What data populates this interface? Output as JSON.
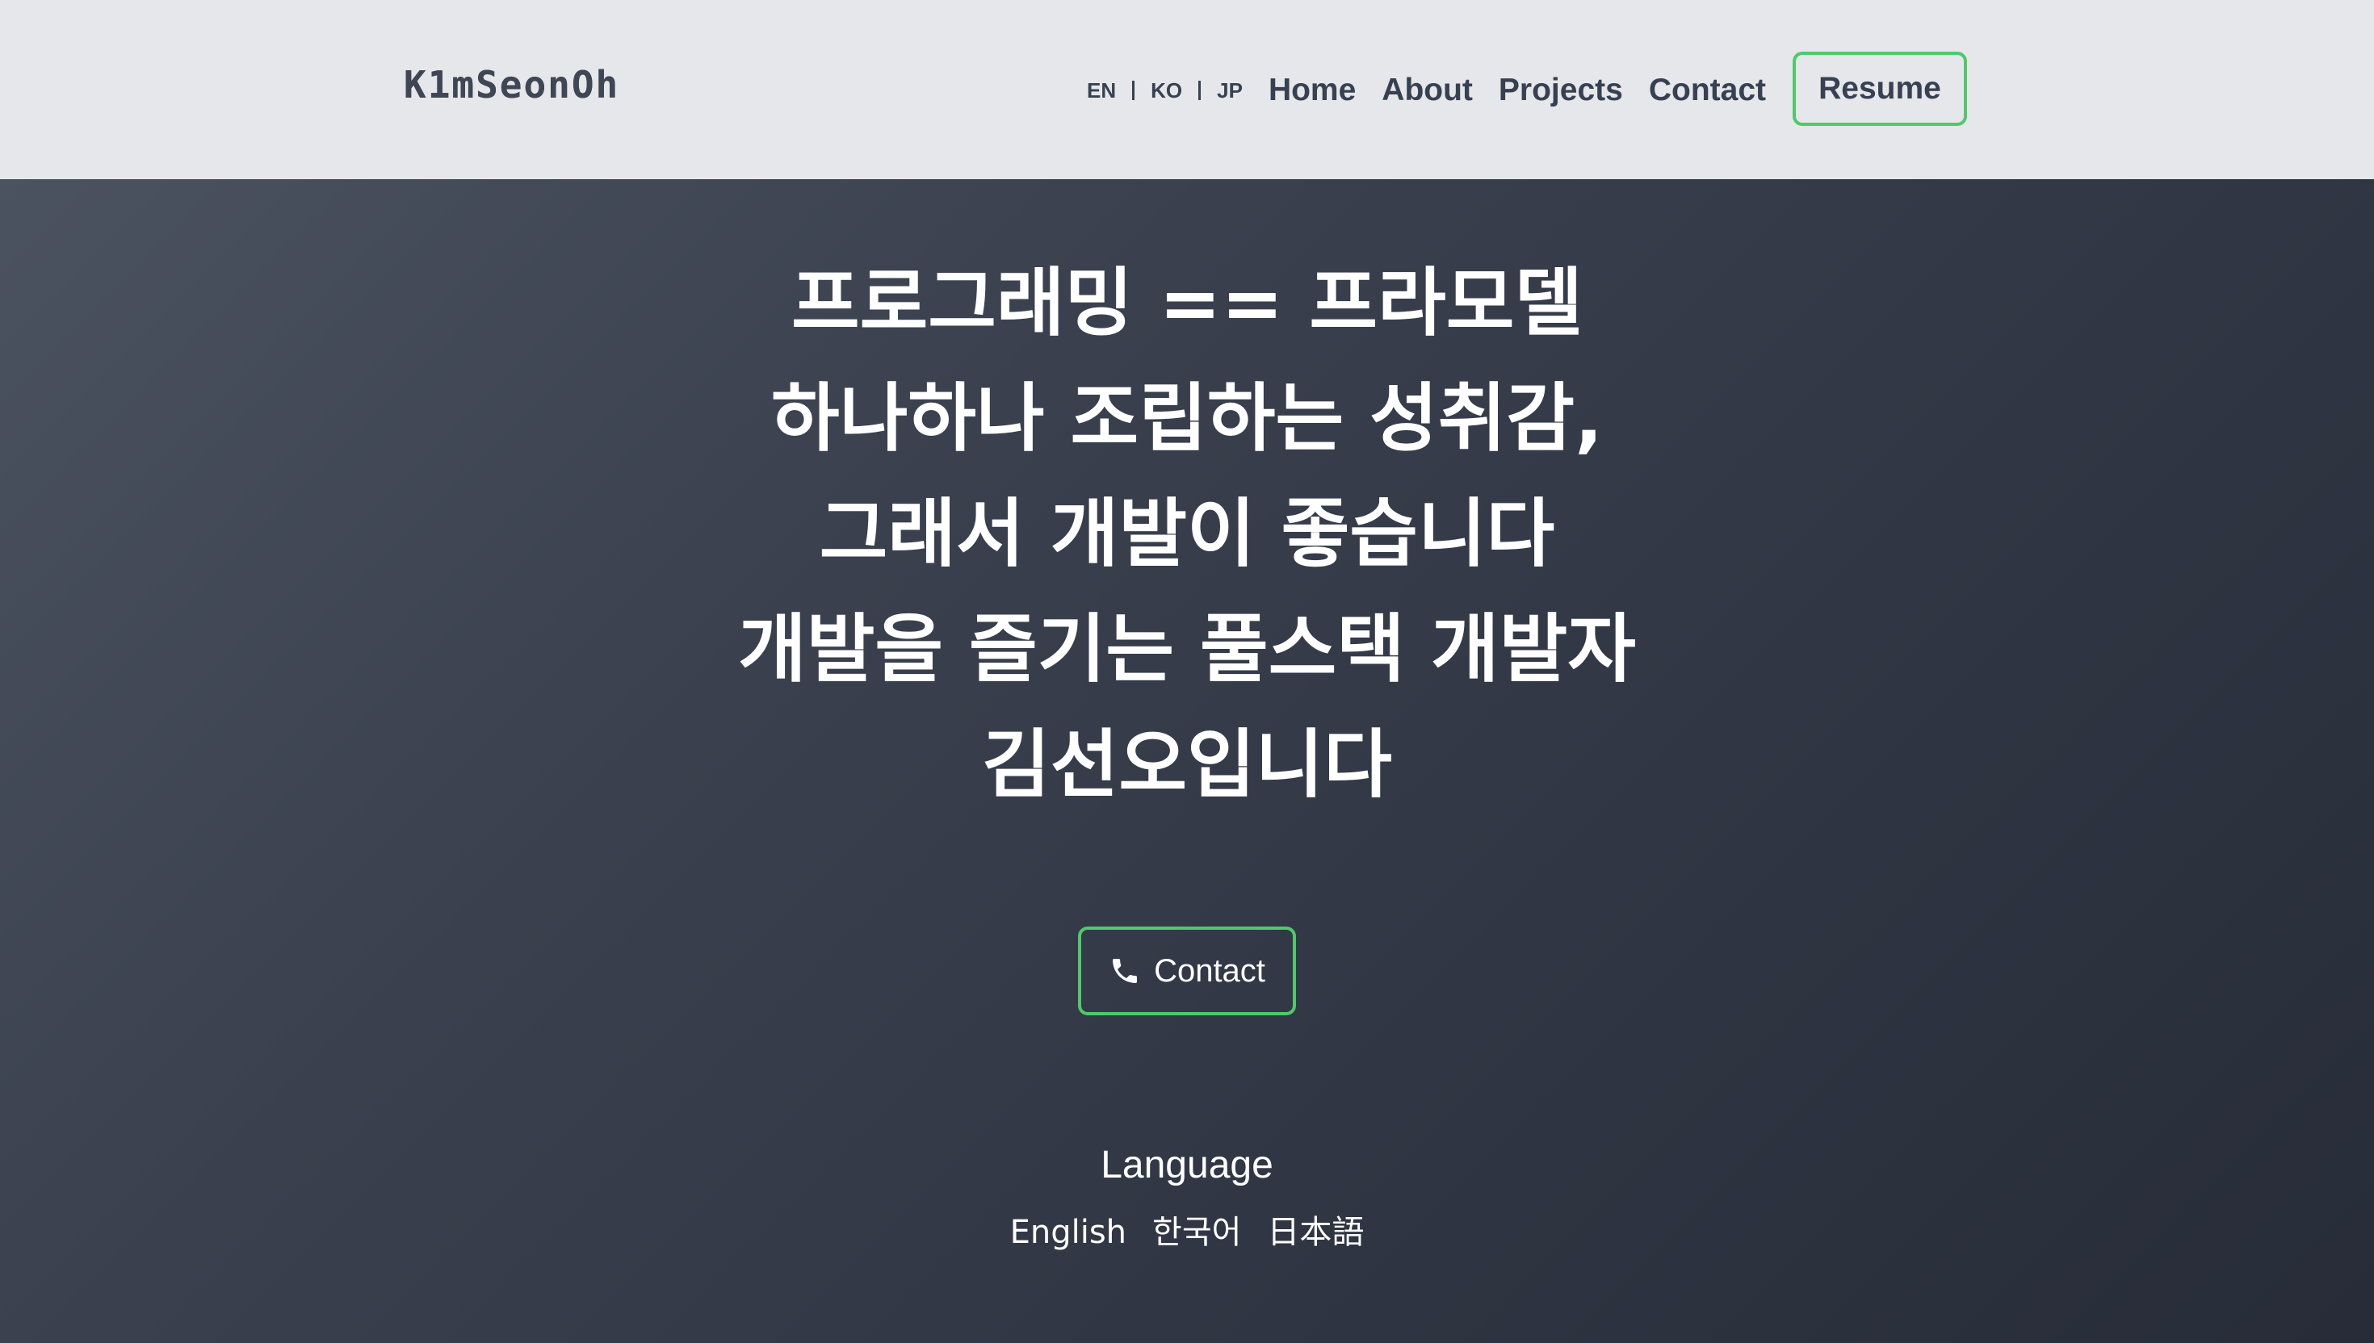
{
  "header": {
    "logo": "K1mSeonOh",
    "languages": [
      "EN",
      "KO",
      "JP"
    ],
    "nav": [
      "Home",
      "About",
      "Projects",
      "Contact"
    ],
    "resume_label": "Resume"
  },
  "hero": {
    "headline_lines": [
      "프로그래밍 == 프라모델",
      "하나하나 조립하는 성취감,",
      "그래서 개발이 좋습니다",
      "개발을 즐기는 풀스택 개발자",
      "김선오입니다"
    ],
    "contact_label": "Contact",
    "contact_icon": "phone-icon"
  },
  "language_section": {
    "title": "Language",
    "options": [
      "English",
      "한국어",
      "日本語"
    ]
  },
  "colors": {
    "header_bg": "#e5e7eb",
    "hero_gradient_start": "#4b5260",
    "hero_gradient_end": "#272c38",
    "accent_border": "#4fc96b",
    "nav_text": "#374151",
    "hero_text": "#ffffff"
  }
}
